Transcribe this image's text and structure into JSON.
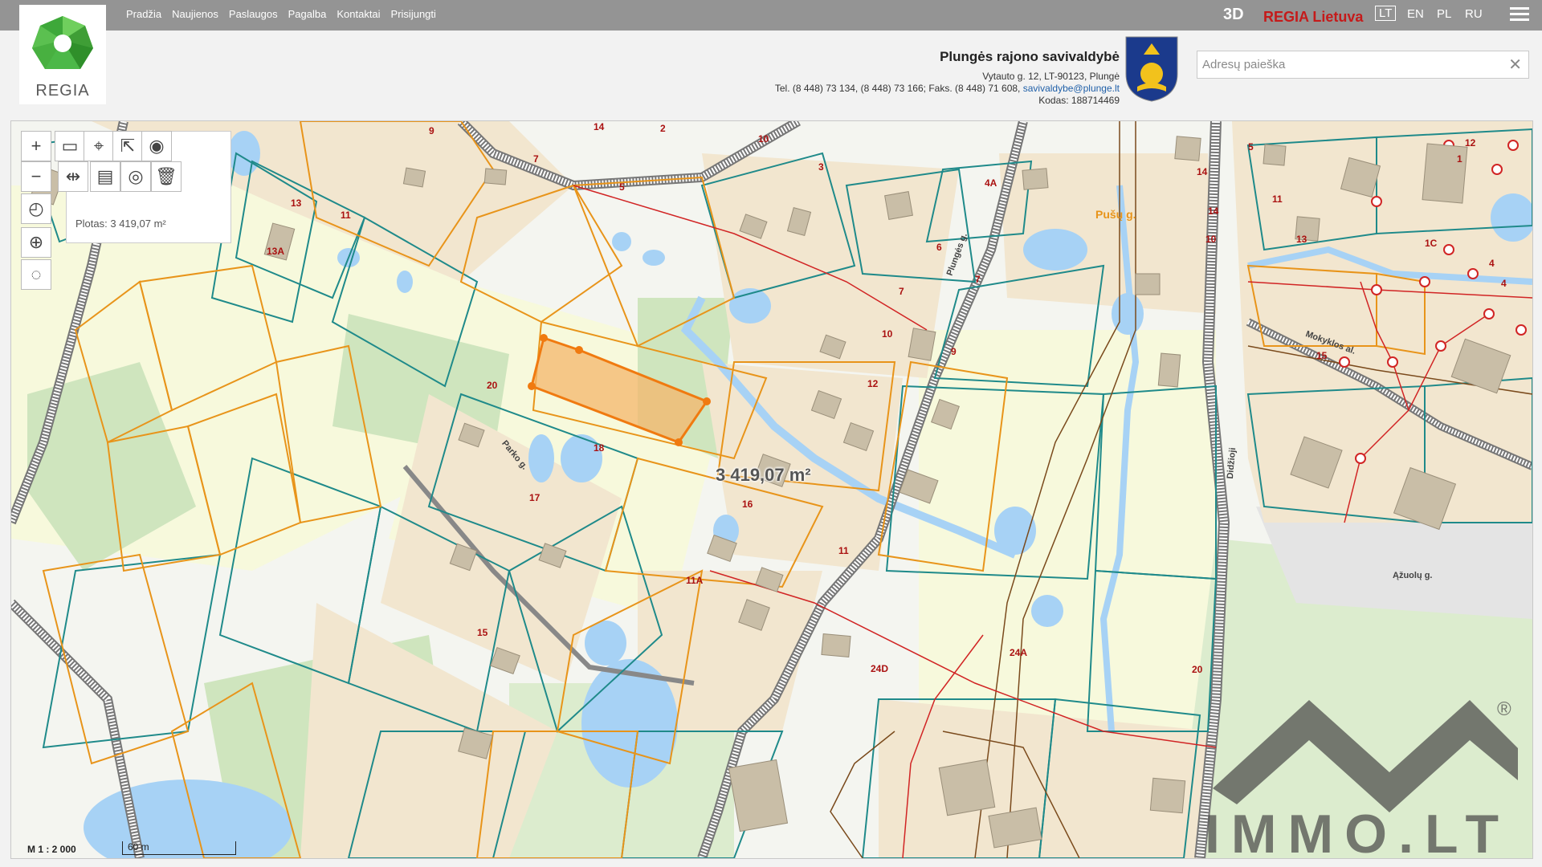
{
  "nav": {
    "items": [
      "Pradžia",
      "Naujienos",
      "Paslaugos",
      "Pagalba",
      "Kontaktai",
      "Prisijungti"
    ]
  },
  "topbar": {
    "mode_3d": "3D",
    "regia_lietuva": "REGIA Lietuva",
    "languages": [
      "LT",
      "EN",
      "PL",
      "RU"
    ],
    "active_language": "LT"
  },
  "logo": {
    "text": "REGIA"
  },
  "municipality": {
    "name": "Plungės rajono savivaldybė",
    "address": "Vytauto g. 12, LT-90123, Plungė",
    "phone_line": "Tel. (8 448) 73 134, (8 448) 73 166; Faks. (8 448) 71 608,",
    "email": "savivaldybe@plunge.lt",
    "code": "Kodas: 188714469"
  },
  "search": {
    "placeholder": "Adresų paieška",
    "clear_icon": "close-icon"
  },
  "tools": {
    "area_readout": "Plotas: 3 419,07 m²",
    "icons": [
      "zoom-in-icon",
      "zoom-out-icon",
      "measure-area-icon",
      "marker-icon",
      "export-icon",
      "point-icon",
      "measure-distance-icon",
      "measure-length-icon",
      "locate-area-icon",
      "trash-icon",
      "history-icon",
      "crosshair-icon",
      "lasso-icon"
    ]
  },
  "map": {
    "measured_area": "3 419,07 m²",
    "scale": "M 1 : 2 000",
    "scale_bar": "60 m",
    "numbers": [
      "9",
      "7",
      "14",
      "2",
      "3",
      "10",
      "4A",
      "7",
      "13",
      "11",
      "13A",
      "5",
      "11",
      "13",
      "6",
      "7",
      "10",
      "12",
      "9",
      "14",
      "20",
      "18",
      "17",
      "16",
      "15",
      "11",
      "11A",
      "24A",
      "24D",
      "20",
      "12",
      "4",
      "1",
      "14",
      "15",
      "5",
      "10",
      "1C",
      "4"
    ],
    "streets": [
      "Pušų g.",
      "Plungės g.",
      "Mokyklos al.",
      "Didžioji",
      "Parko g.",
      "Ąžuolų g."
    ]
  },
  "watermark": {
    "text": "IMMO.LT",
    "registered": "®"
  }
}
